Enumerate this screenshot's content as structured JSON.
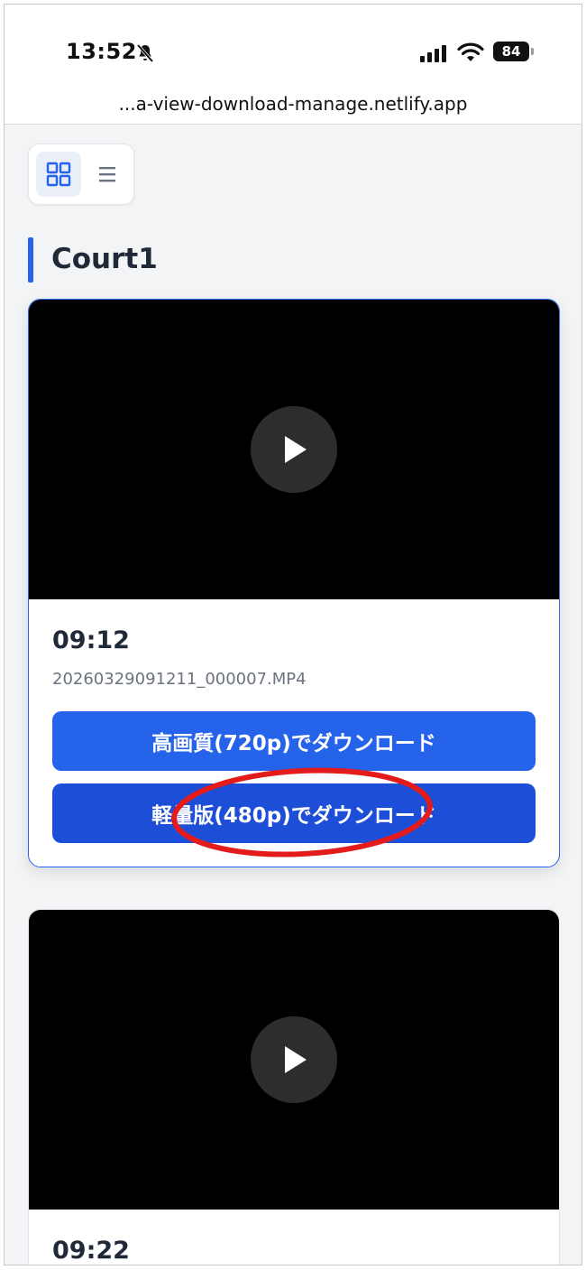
{
  "status_bar": {
    "time": "13:52",
    "battery": "84",
    "icons": [
      "bell-slash-icon",
      "signal-icon",
      "wifi-icon",
      "battery-icon"
    ]
  },
  "browser": {
    "url": "...a-view-download-manage.netlify.app"
  },
  "view_toggle": {
    "icons": [
      "grid-icon",
      "list-icon"
    ],
    "active": "grid"
  },
  "section": {
    "title": "Court1"
  },
  "clips": [
    {
      "time": "09:12",
      "filename": "20260329091211_000007.MP4",
      "download_hq_label": "高画質(720p)でダウンロード",
      "download_lite_label": "軽量版(480p)でダウンロード"
    },
    {
      "time": "09:22"
    }
  ],
  "colors": {
    "accent": "#2563eb",
    "accent_dark": "#1d4ed8",
    "annotation": "#e31b1b",
    "background": "#f3f4f6"
  }
}
